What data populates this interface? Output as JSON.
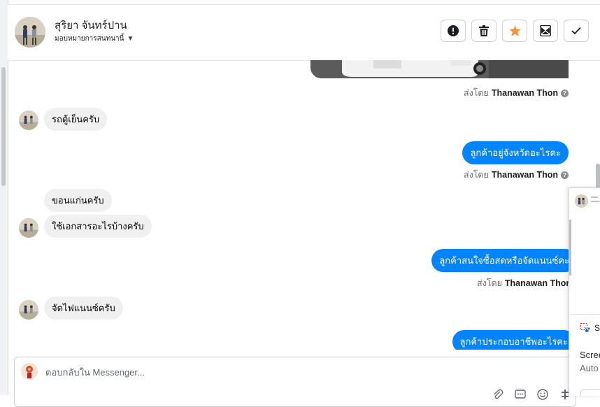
{
  "header": {
    "contact_name": "สุริยา จันทร์ปาน",
    "assign_label": "มอบหมายการสนทนานี้",
    "actions": [
      {
        "name": "spam-button",
        "icon": "alert-circle-icon"
      },
      {
        "name": "delete-button",
        "icon": "trash-icon"
      },
      {
        "name": "star-button",
        "icon": "star-icon"
      },
      {
        "name": "mark-unread-button",
        "icon": "envelope-icon"
      },
      {
        "name": "done-button",
        "icon": "check-icon"
      }
    ]
  },
  "messages": [
    {
      "type": "image",
      "direction": "out"
    },
    {
      "type": "sent_by",
      "prefix": "ส่งโดย",
      "name": "Thanawan Thon"
    },
    {
      "type": "text",
      "direction": "in",
      "text": "รถตู้เย็นครับ"
    },
    {
      "type": "text",
      "direction": "out",
      "text": "ลูกค้าอยู่จังหวัดอะไรคะ"
    },
    {
      "type": "sent_by",
      "prefix": "ส่งโดย",
      "name": "Thanawan Thon"
    },
    {
      "type": "text",
      "direction": "in",
      "text": "ขอนแก่นครับ"
    },
    {
      "type": "text",
      "direction": "in",
      "text": "ใช้เอกสารอะไรบ้างครับ"
    },
    {
      "type": "text",
      "direction": "out",
      "text": "ลูกค้าสนใจซื้อสดหรือจัดแนนซ์คะ"
    },
    {
      "type": "sent_by",
      "prefix": "ส่งโดย",
      "name": "Thanawan Thon"
    },
    {
      "type": "text",
      "direction": "in",
      "text": "จัดไฟแนนซ์ครับ"
    },
    {
      "type": "text",
      "direction": "out",
      "text": "ลูกค้าประกอบอาชีพอะไรคะ"
    }
  ],
  "composer": {
    "placeholder": "ตอบกลับใน Messenger...",
    "tools": [
      "attachment-icon",
      "saved-reply-icon",
      "emoji-icon",
      "more-icon"
    ]
  },
  "popup": {
    "app_label": "S",
    "line1": "Scree",
    "line2": "Auto"
  },
  "colors": {
    "outgoing_bubble": "#0084ff",
    "incoming_bubble": "#f0f0f0",
    "star": "#f7923a"
  }
}
